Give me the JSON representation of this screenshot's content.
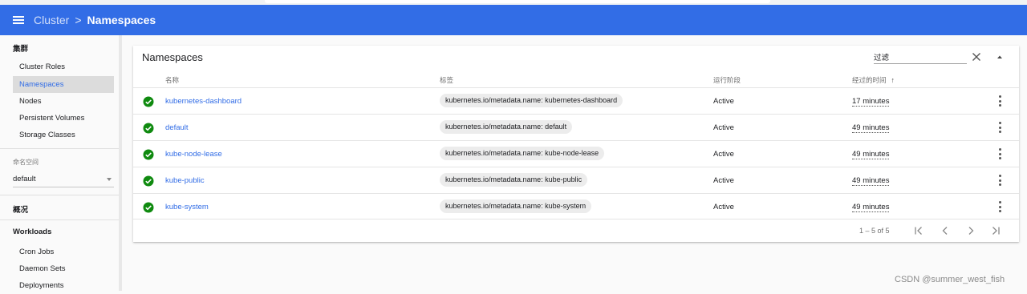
{
  "header": {
    "breadcrumb_parent": "Cluster",
    "breadcrumb_separator": ">",
    "breadcrumb_current": "Namespaces"
  },
  "sidebar": {
    "cluster_heading": "集群",
    "cluster_items": [
      {
        "label": "Cluster Roles"
      },
      {
        "label": "Namespaces",
        "active": true
      },
      {
        "label": "Nodes"
      },
      {
        "label": "Persistent Volumes"
      },
      {
        "label": "Storage Classes"
      }
    ],
    "namespace_caption": "命名空间",
    "namespace_selected": "default",
    "overview_heading": "概况",
    "workloads_heading": "Workloads",
    "workload_items": [
      {
        "label": "Cron Jobs"
      },
      {
        "label": "Daemon Sets"
      },
      {
        "label": "Deployments"
      }
    ]
  },
  "card": {
    "title": "Namespaces",
    "filter_placeholder": "过滤",
    "columns": {
      "name": "名称",
      "labels": "标签",
      "phase": "运行阶段",
      "age": "经过的时间",
      "sort_indicator": "↑"
    },
    "rows": [
      {
        "name": "kubernetes-dashboard",
        "label": "kubernetes.io/metadata.name: kubernetes-dashboard",
        "phase": "Active",
        "age": "17 minutes"
      },
      {
        "name": "default",
        "label": "kubernetes.io/metadata.name: default",
        "phase": "Active",
        "age": "49 minutes"
      },
      {
        "name": "kube-node-lease",
        "label": "kubernetes.io/metadata.name: kube-node-lease",
        "phase": "Active",
        "age": "49 minutes"
      },
      {
        "name": "kube-public",
        "label": "kubernetes.io/metadata.name: kube-public",
        "phase": "Active",
        "age": "49 minutes"
      },
      {
        "name": "kube-system",
        "label": "kubernetes.io/metadata.name: kube-system",
        "phase": "Active",
        "age": "49 minutes"
      }
    ],
    "pagination": {
      "range": "1 – 5 of 5"
    }
  },
  "watermark": "CSDN @summer_west_fish",
  "colors": {
    "app_bar": "#326de6",
    "status_ok": "#0f8a0f",
    "link": "#326de6"
  }
}
